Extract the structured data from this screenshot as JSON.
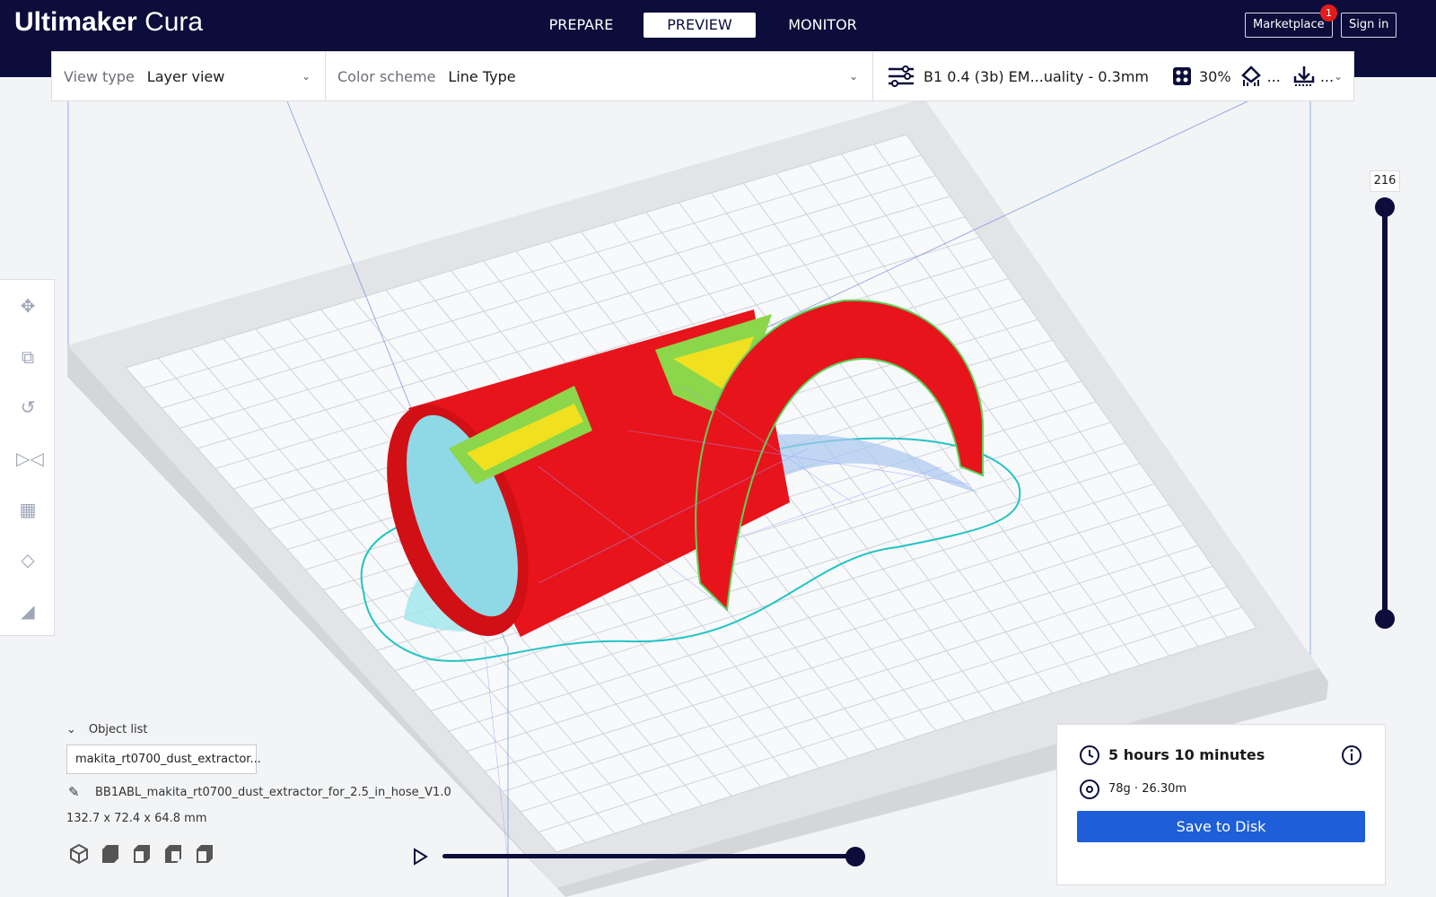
{
  "header": {
    "logo_bold": "Ultimaker",
    "logo_light": "Cura",
    "tabs": [
      {
        "label": "PREPARE"
      },
      {
        "label": "PREVIEW"
      },
      {
        "label": "MONITOR"
      }
    ],
    "marketplace": "Marketplace",
    "marketplace_badge": "1",
    "sign_in": "Sign in"
  },
  "toolbar": {
    "view_type_label": "View type",
    "view_type_value": "Layer view",
    "color_scheme_label": "Color scheme",
    "color_scheme_value": "Line Type",
    "profile": "B1 0.4 (3b) EM...uality - 0.3mm",
    "infill": "30%",
    "support": "...",
    "adhesion": "..."
  },
  "tools": [
    "move-icon",
    "scale-icon",
    "rotate-icon",
    "mirror-icon",
    "per-model-settings-icon",
    "support-blocker-icon",
    "lay-flat-icon"
  ],
  "objects": {
    "header": "Object list",
    "selected": "makita_rt0700_dust_extractor...",
    "name": "BB1ABL_makita_rt0700_dust_extractor_for_2.5_in_hose_V1.0",
    "dimensions": "132.7 x 72.4 x 64.8 mm"
  },
  "layer_slider": {
    "current_layer": "216",
    "max_fraction": 1.0,
    "min_fraction": 0.0
  },
  "path_slider": {
    "fraction": 1.0
  },
  "print_info": {
    "time": "5 hours 10 minutes",
    "material": "78g · 26.30m",
    "save_label": "Save to Disk"
  },
  "colors": {
    "header": "#0c0d3b",
    "accent": "#1e5ed8",
    "wall": "#e8141b",
    "skin": "#ffd400",
    "infill": "#7ce36b",
    "support": "#7fe4e4",
    "travel": "#8f8fff"
  }
}
